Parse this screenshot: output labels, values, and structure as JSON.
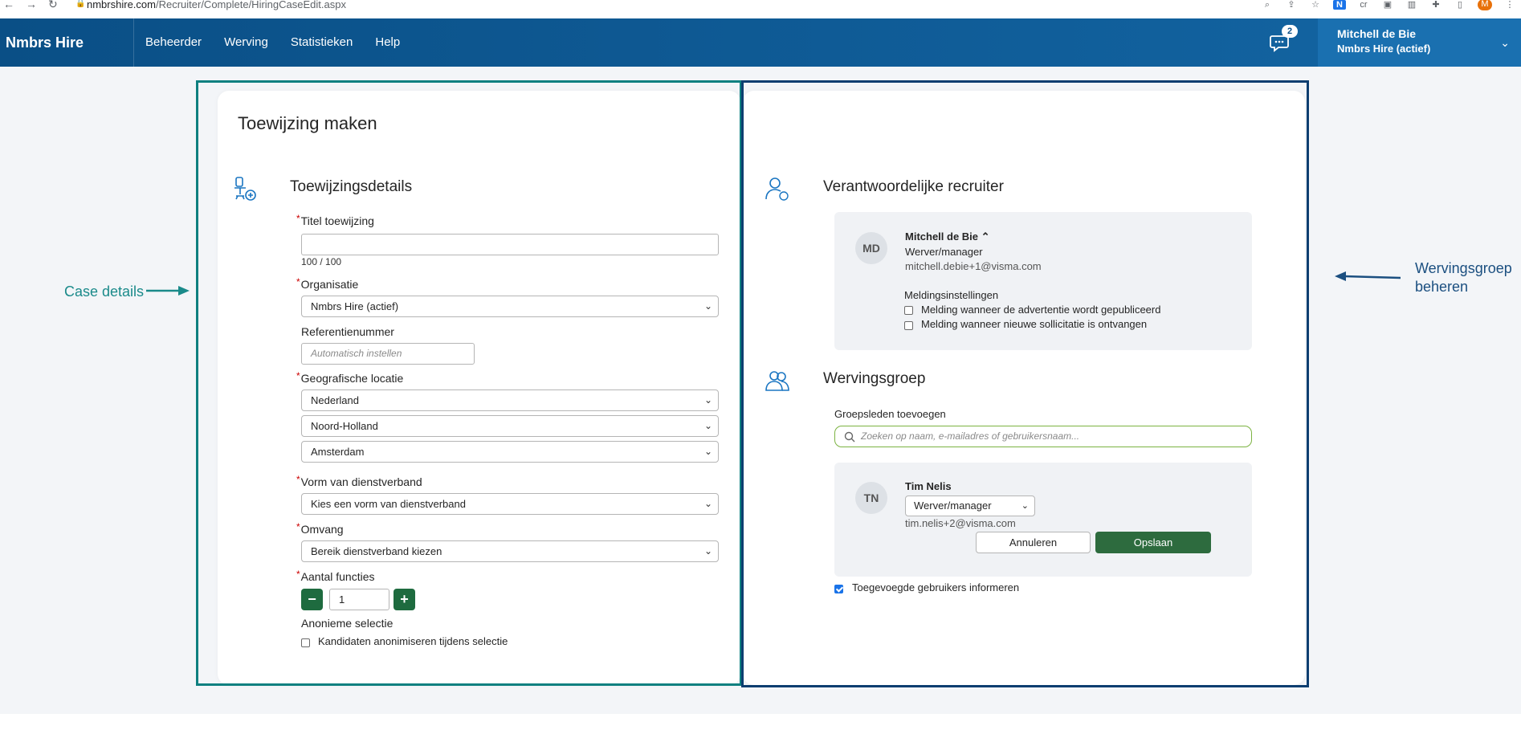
{
  "browser": {
    "url_host": "nmbrshire.com",
    "url_path": "/Recruiter/Complete/HiringCaseEdit.aspx",
    "ext_avatar": "M"
  },
  "header": {
    "brand": "Nmbrs Hire",
    "nav": [
      "Beheerder",
      "Werving",
      "Statistieken",
      "Help"
    ],
    "chat_badge": "2",
    "user_name": "Mitchell de Bie",
    "user_company": "Nmbrs Hire (actief)"
  },
  "annotations": {
    "left": "Case details",
    "right_line1": "Wervingsgroep",
    "right_line2": "beheren",
    "left_color": "#0e8080",
    "right_color": "#0d3e70"
  },
  "left": {
    "page_title": "Toewijzing maken",
    "section_title": "Toewijzingsdetails",
    "title_label": "Titel toewijzing",
    "title_value": "",
    "title_counter": "100 / 100",
    "org_label": "Organisatie",
    "org_value": "Nmbrs Hire (actief)",
    "ref_label": "Referentienummer",
    "ref_placeholder": "Automatisch instellen",
    "geo_label": "Geografische locatie",
    "geo_country": "Nederland",
    "geo_province": "Noord-Holland",
    "geo_city": "Amsterdam",
    "employment_label": "Vorm van dienstverband",
    "employment_value": "Kies een vorm van dienstverband",
    "scope_label": "Omvang",
    "scope_value": "Bereik dienstverband kiezen",
    "positions_label": "Aantal functies",
    "positions_value": "1",
    "anon_label": "Anonieme selectie",
    "anon_checkbox": "Kandidaten anonimiseren tijdens selectie",
    "anon_checked": false
  },
  "right": {
    "recruiter_title": "Verantwoordelijke recruiter",
    "recruiter": {
      "initials": "MD",
      "name": "Mitchell de Bie",
      "role": "Werver/manager",
      "email": "mitchell.debie+1@visma.com",
      "notif_title": "Meldingsinstellingen",
      "notif_1": "Melding wanneer de advertentie wordt gepubliceerd",
      "notif_2": "Melding wanneer nieuwe sollicitatie is ontvangen",
      "notif_1_checked": false,
      "notif_2_checked": false
    },
    "group_title": "Wervingsgroep",
    "add_members_label": "Groepsleden toevoegen",
    "search_placeholder": "Zoeken op naam, e-mailadres of gebruikersnaam...",
    "member": {
      "initials": "TN",
      "name": "Tim Nelis",
      "role": "Werver/manager",
      "email": "tim.nelis+2@visma.com",
      "cancel": "Annuleren",
      "save": "Opslaan"
    },
    "inform_label": "Toegevoegde gebruikers informeren",
    "inform_checked": true
  }
}
